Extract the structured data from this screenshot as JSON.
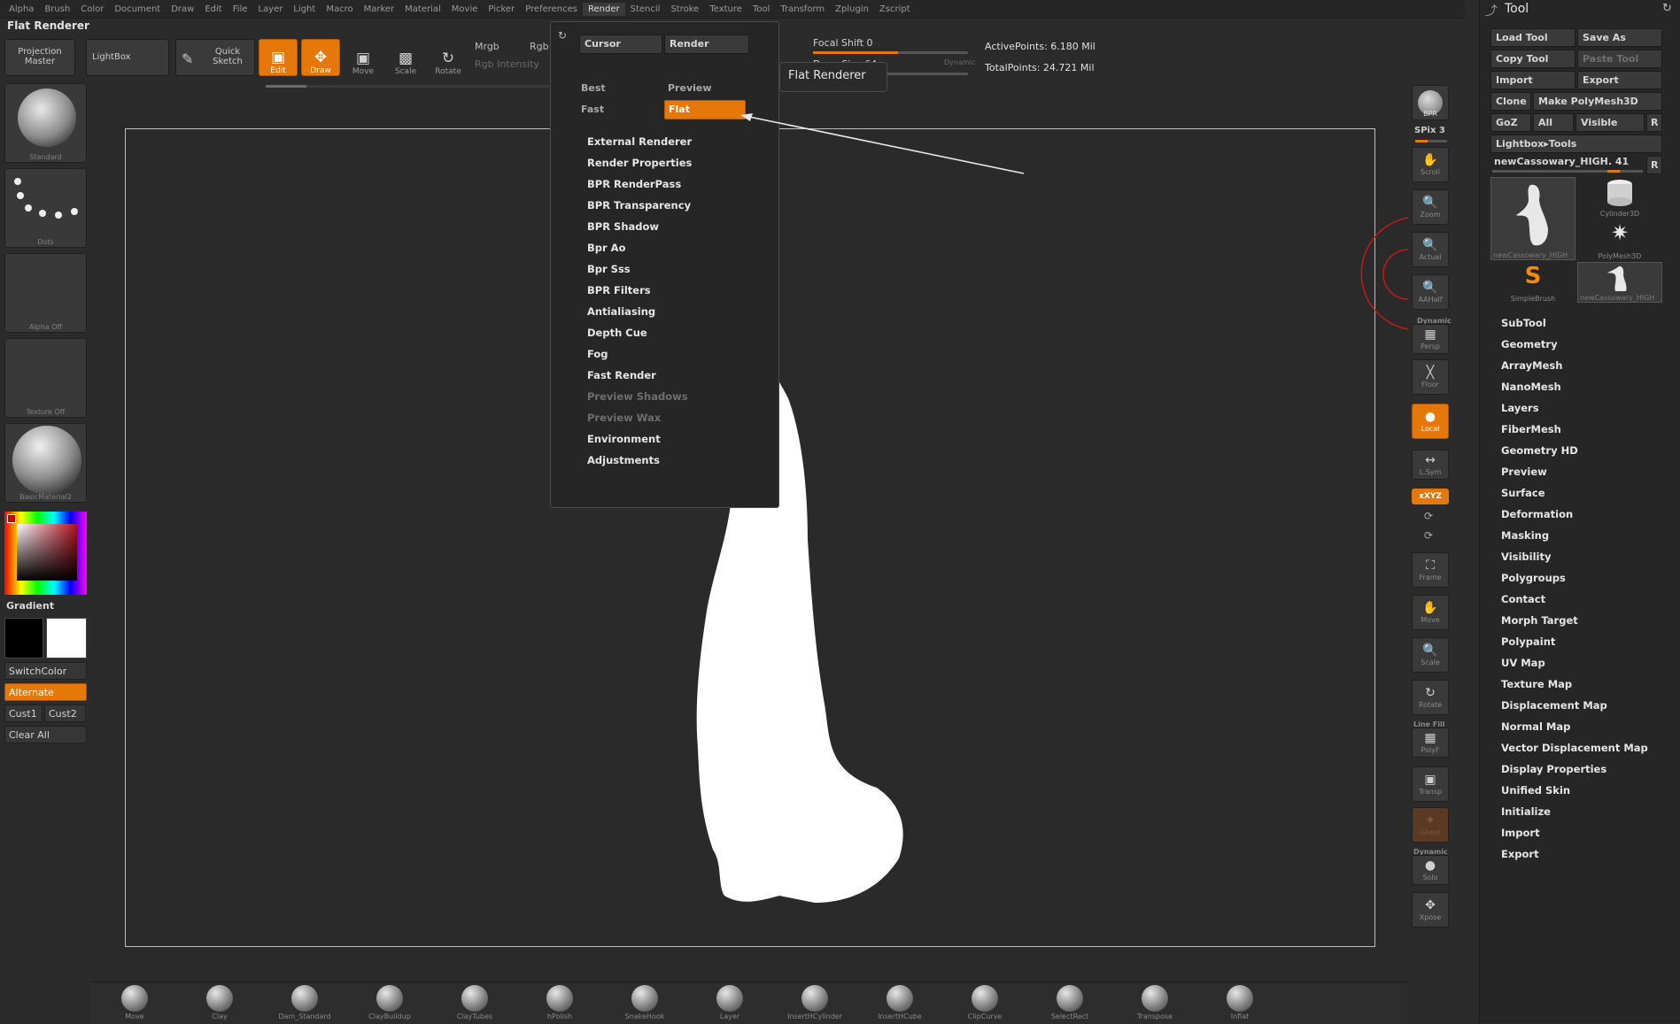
{
  "menu": [
    "Alpha",
    "Brush",
    "Color",
    "Document",
    "Draw",
    "Edit",
    "File",
    "Layer",
    "Light",
    "Macro",
    "Marker",
    "Material",
    "Movie",
    "Picker",
    "Preferences",
    "Render",
    "Stencil",
    "Stroke",
    "Texture",
    "Tool",
    "Transform",
    "Zplugin",
    "Zscript"
  ],
  "menu_active": "Render",
  "doc_title": "Flat Renderer",
  "toolbar": {
    "projection_master": "Projection Master",
    "lightbox": "LightBox",
    "quick_sketch": "Quick Sketch",
    "edit": "Edit",
    "draw": "Draw",
    "move": "Move",
    "scale": "Scale",
    "rotate": "Rotate",
    "mrgb": "Mrgb",
    "rgb": "Rgb",
    "rgb_intensity": "Rgb Intensity",
    "focal_shift": "Focal Shift 0",
    "draw_size": "Draw Size 64",
    "dynamic": "Dynamic",
    "active_points": "ActivePoints: 6.180 Mil",
    "total_points": "TotalPoints: 24.721 Mil"
  },
  "tooltip": "Flat Renderer",
  "left_shelf": {
    "brush": "Standard",
    "stroke": "Dots",
    "alpha": "Alpha Off",
    "texture": "Texture Off",
    "material": "BasicMaterial2",
    "gradient": "Gradient",
    "switch_color": "SwitchColor",
    "alternate": "Alternate",
    "cust1": "Cust1",
    "cust2": "Cust2",
    "clear_all": "Clear All"
  },
  "render_menu": {
    "cursor": "Cursor",
    "render": "Render",
    "best": "Best",
    "preview": "Preview",
    "fast": "Fast",
    "flat": "Flat",
    "items": [
      {
        "label": "External Renderer",
        "dim": false
      },
      {
        "label": "Render Properties",
        "dim": false
      },
      {
        "label": "BPR RenderPass",
        "dim": false
      },
      {
        "label": "BPR Transparency",
        "dim": false
      },
      {
        "label": "BPR Shadow",
        "dim": false
      },
      {
        "label": "Bpr Ao",
        "dim": false
      },
      {
        "label": "Bpr Sss",
        "dim": false
      },
      {
        "label": "BPR Filters",
        "dim": false
      },
      {
        "label": "Antialiasing",
        "dim": false
      },
      {
        "label": "Depth Cue",
        "dim": false
      },
      {
        "label": "Fog",
        "dim": false
      },
      {
        "label": "Fast Render",
        "dim": false
      },
      {
        "label": "Preview Shadows",
        "dim": true
      },
      {
        "label": "Preview Wax",
        "dim": true
      },
      {
        "label": "Environment",
        "dim": false
      },
      {
        "label": "Adjustments",
        "dim": false
      }
    ]
  },
  "right_tools": {
    "bpr": "BPR",
    "spix": "SPix 3",
    "scroll": "Scroll",
    "zoom": "Zoom",
    "actual": "Actual",
    "aahalf": "AAHalf",
    "dynamic": "Dynamic",
    "persp": "Persp",
    "floor": "Floor",
    "local": "Local",
    "lsym": "L.Sym",
    "xyz": "xXYZ",
    "frame": "Frame",
    "move": "Move",
    "scale": "Scale",
    "rotate": "Rotate",
    "line_fill": "Line Fill",
    "polyf": "PolyF",
    "transp": "Transp",
    "ghost": "Ghost",
    "solo": "Solo",
    "xpose": "Xpose"
  },
  "tool_palette": {
    "title": "Tool",
    "load_tool": "Load Tool",
    "save_as": "Save As",
    "copy_tool": "Copy Tool",
    "paste_tool": "Paste Tool",
    "import": "Import",
    "export": "Export",
    "clone": "Clone",
    "make_polymesh": "Make PolyMesh3D",
    "goz": "GoZ",
    "all": "All",
    "visible": "Visible",
    "r": "R",
    "lightbox_tools": "Lightbox▸Tools",
    "current_tool": "newCassowary_HIGH. 41",
    "thumbs": [
      "newCassowary_HIGH",
      "Cylinder3D",
      "SimpleBrush",
      "PolyMesh3D",
      "newCassowary_HIGH"
    ],
    "subpalettes": [
      "SubTool",
      "Geometry",
      "ArrayMesh",
      "NanoMesh",
      "Layers",
      "FiberMesh",
      "Geometry HD",
      "Preview",
      "Surface",
      "Deformation",
      "Masking",
      "Visibility",
      "Polygroups",
      "Contact",
      "Morph Target",
      "Polypaint",
      "UV Map",
      "Texture Map",
      "Displacement Map",
      "Normal Map",
      "Vector Displacement Map",
      "Display Properties",
      "Unified Skin",
      "Initialize",
      "Import",
      "Export"
    ]
  },
  "brush_bar": [
    "Move",
    "Clay",
    "Dam_Standard",
    "ClayBuildup",
    "ClayTubes",
    "hPolish",
    "SnakeHook",
    "Layer",
    "InsertHCylinder",
    "InsertHCube",
    "ClipCurve",
    "SelectRect",
    "Transpose",
    "Inflat"
  ],
  "colors": {
    "accent": "#e6780a",
    "bg": "#2b2b2b",
    "panel": "#262626",
    "silhouette": "#ffffff"
  }
}
